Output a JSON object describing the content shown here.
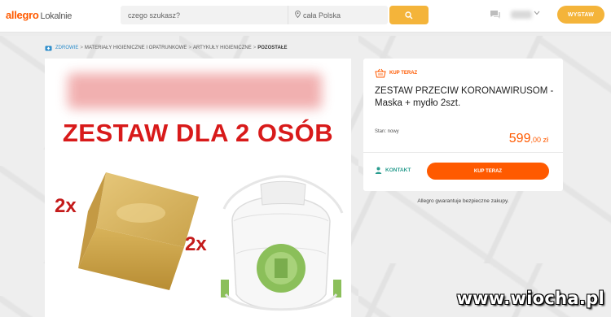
{
  "header": {
    "logo_text": "allegro",
    "logo_sub": "Lokalnie",
    "search_placeholder": "czego szukasz?",
    "location_value": "cała Polska",
    "post_button": "WYSTAW"
  },
  "breadcrumb": {
    "items": [
      "ZDROWIE",
      "MATERIAŁY HIGIENICZNE I OPATRUNKOWE",
      "ARTYKUŁY HIGIENICZNE",
      "POZOSTAŁE"
    ],
    "separator": ">"
  },
  "image": {
    "headline": "ZESTAW DLA 2 OSÓB",
    "soap_qty": "2x",
    "mask_qty": "2x"
  },
  "offer": {
    "badge": "KUP TERAZ",
    "title": "ZESTAW PRZECIW KORONAWIRUSOM - Maska + mydło 2szt.",
    "condition": "Stan: nowy",
    "price_int": "599",
    "price_dec": ",00 zł",
    "contact_label": "KONTAKT",
    "buy_button": "KUP TERAZ"
  },
  "guarantee": "Allegro gwarantuje bezpieczne zakupy.",
  "watermark": "www.wiocha.pl",
  "colors": {
    "brand": "#ff5a00",
    "accent_yellow": "#f4b43a",
    "contact_teal": "#2a9d8f",
    "headline_red": "#d81a1a"
  }
}
